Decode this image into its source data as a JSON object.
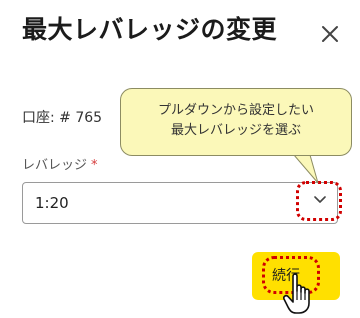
{
  "dialog": {
    "title": "最大レバレッジの変更",
    "account_label": "口座: # 765",
    "leverage_field_label": "レバレッジ",
    "required_mark": "*",
    "leverage_selected": "1:20",
    "continue_label": "続行"
  },
  "tooltip": {
    "line1": "プルダウンから設定したい",
    "line2": "最大レバレッジを選ぶ"
  },
  "colors": {
    "accent": "#ffe000",
    "highlight_ring": "#d10000",
    "tooltip_bg": "#fbf8b9",
    "required": "#d63b3b"
  },
  "icons": {
    "close": "close-icon",
    "dropdown": "chevron-down-icon",
    "pointer": "hand-pointer-icon"
  }
}
